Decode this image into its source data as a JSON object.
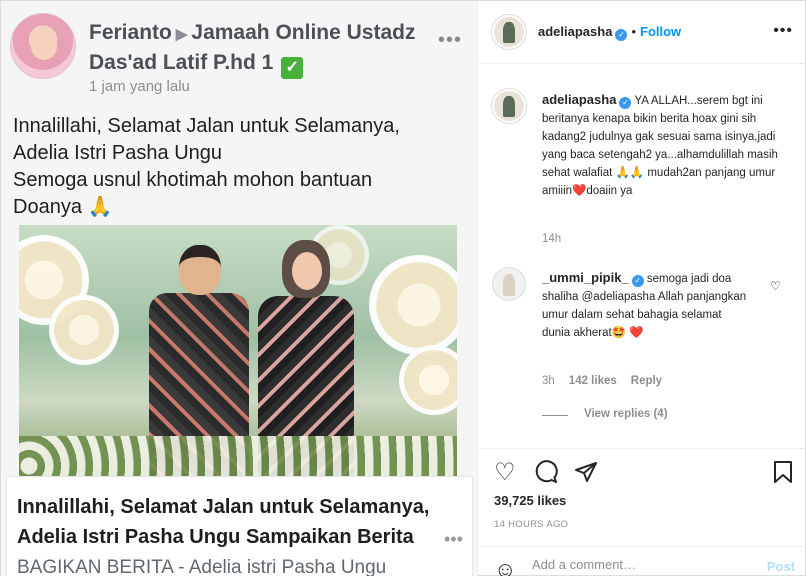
{
  "image_post": {
    "fb_header_poster": "Ferianto",
    "fb_header_group": "Jamaah Online Ustadz Das'ad Latif P.hd 1",
    "fb_verified_mark": "✓",
    "fb_time": "1 jam yang lalu",
    "fb_text_line1": "Innalillahi, Selamat Jalan untuk Selamanya,",
    "fb_text_line2": "Adelia Istri Pasha Ungu",
    "fb_text_line3": "Semoga usnul khotimah mohon bantuan",
    "fb_text_line4": "Doanya 🙏",
    "card_title": "Innalillahi, Selamat Jalan untuk Selamanya, Adelia Istri Pasha Ungu Sampaikan Berita",
    "card_subtitle": "BAGIKAN BERITA - Adelia istri Pasha Ungu"
  },
  "header": {
    "username": "adeliapasha",
    "separator": "•",
    "follow_label": "Follow",
    "more_icon": "•••"
  },
  "comments": [
    {
      "username": "adeliapasha",
      "text": "YA ALLAH...serem bgt ini beritanya kenapa bikin berita hoax gini sih kadang2 judulnya gak sesuai sama isinya,jadi yang baca setengah2 ya...alhamdulillah masih sehat walafiat 🙏🙏 mudah2an panjang umur amiiin❤️doaiin ya",
      "time": "14h"
    },
    {
      "username": "_ummi_pipik_",
      "text": "semoga jadi doa shaliha @adeliapasha Allah panjangkan umur dalam sehat bahagia selamat dunia akherat🤩 ❤️",
      "time": "3h",
      "likes": "142 likes",
      "reply_label": "Reply",
      "view_replies": "View replies (4)"
    }
  ],
  "actions": {
    "likes_count": "39,725 likes",
    "date": "14 HOURS AGO"
  },
  "add_comment": {
    "placeholder": "Add a comment…",
    "post_label": "Post"
  },
  "colors": {
    "accent": "#0095f6",
    "verified": "#3897f0",
    "muted": "#8e8e8e",
    "text": "#262626"
  }
}
